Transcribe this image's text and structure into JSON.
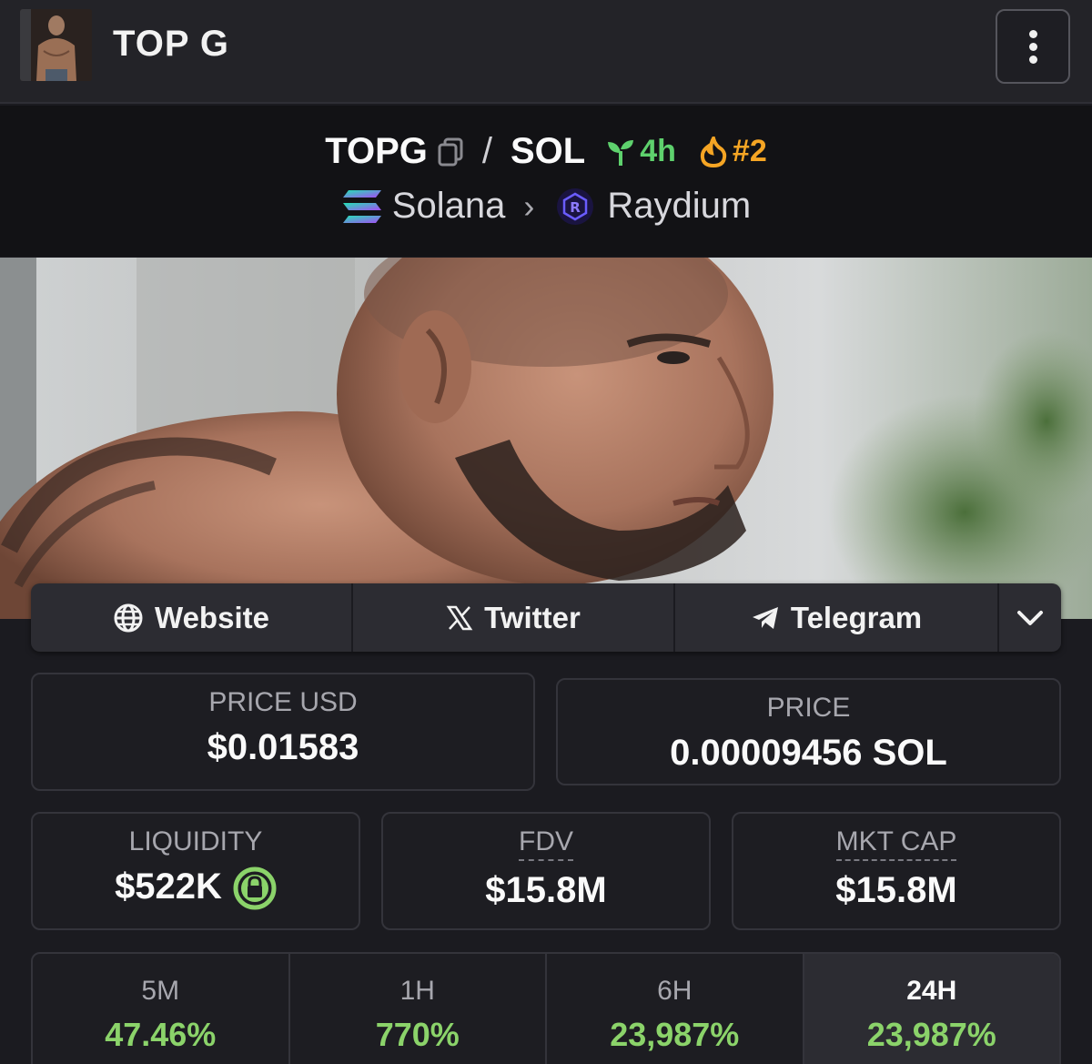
{
  "header": {
    "title": "TOP G"
  },
  "pair": {
    "base": "TOPG",
    "slash": "/",
    "quote": "SOL",
    "age": "4h",
    "rank": "#2",
    "chain": "Solana",
    "dex": "Raydium"
  },
  "links": [
    {
      "label": "Website",
      "icon": "globe-icon"
    },
    {
      "label": "Twitter",
      "icon": "x-icon"
    },
    {
      "label": "Telegram",
      "icon": "telegram-icon"
    }
  ],
  "stats": {
    "price_usd": {
      "label": "PRICE USD",
      "value": "$0.01583"
    },
    "price_native": {
      "label": "PRICE",
      "value": "0.00009456 SOL"
    },
    "liquidity": {
      "label": "LIQUIDITY",
      "value": "$522K"
    },
    "fdv": {
      "label": "FDV",
      "value": "$15.8M"
    },
    "mkt_cap": {
      "label": "MKT CAP",
      "value": "$15.8M"
    }
  },
  "changes": [
    {
      "label": "5M",
      "value": "47.46%"
    },
    {
      "label": "1H",
      "value": "770%"
    },
    {
      "label": "6H",
      "value": "23,987%"
    },
    {
      "label": "24H",
      "value": "23,987%"
    }
  ],
  "colors": {
    "positive": "#8bd36a",
    "age": "#5ed16d",
    "rank": "#f5a524",
    "lock": "#8bd36a"
  }
}
